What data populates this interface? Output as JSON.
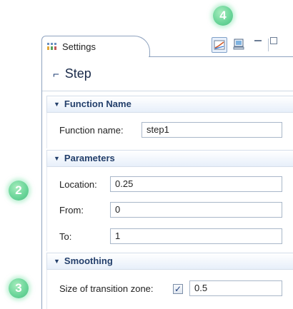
{
  "callouts": {
    "two": "2",
    "three": "3",
    "four": "4"
  },
  "tab": {
    "label": "Settings"
  },
  "toolbar": {
    "active_button_icon": "plot-icon",
    "second_button_icon": "monitor-icon"
  },
  "node": {
    "title": "Step",
    "glyph": "⌐"
  },
  "sections": {
    "function_name": {
      "title": "Function Name",
      "name_label": "Function name:",
      "name_value": "step1"
    },
    "parameters": {
      "title": "Parameters",
      "location_label": "Location:",
      "location_value": "0.25",
      "from_label": "From:",
      "from_value": "0",
      "to_label": "To:",
      "to_value": "1"
    },
    "smoothing": {
      "title": "Smoothing",
      "size_label": "Size of transition zone:",
      "size_checked": true,
      "size_value": "0.5"
    }
  },
  "colors": {
    "accent": "#233f6b",
    "callout": "#6cd69a",
    "border": "#8fa3bf"
  }
}
